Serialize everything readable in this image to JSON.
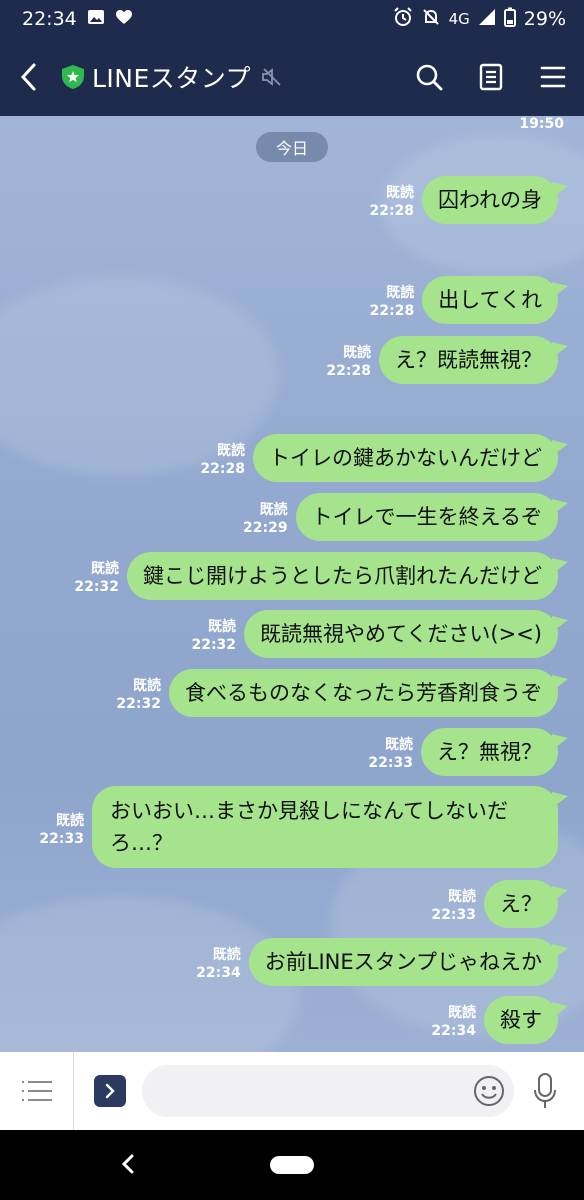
{
  "status_bar": {
    "time": "22:34",
    "network": "4G",
    "battery": "29%"
  },
  "header": {
    "title": "LINEスタンプ"
  },
  "chat": {
    "previous_time": "19:50",
    "date_label": "今日",
    "messages": [
      {
        "read": "既読",
        "time": "22:28",
        "text": "囚われの身"
      },
      {
        "read": "既読",
        "time": "22:28",
        "text": "出してくれ"
      },
      {
        "read": "既読",
        "time": "22:28",
        "text": "え？既読無視？"
      },
      {
        "read": "既読",
        "time": "22:28",
        "text": "トイレの鍵あかないんだけど"
      },
      {
        "read": "既読",
        "time": "22:29",
        "text": "トイレで一生を終えるぞ"
      },
      {
        "read": "既読",
        "time": "22:32",
        "text": "鍵こじ開けようとしたら爪割れたんだけど"
      },
      {
        "read": "既読",
        "time": "22:32",
        "text": "既読無視やめてください(><)"
      },
      {
        "read": "既読",
        "time": "22:32",
        "text": "食べるものなくなったら芳香剤食うぞ"
      },
      {
        "read": "既読",
        "time": "22:33",
        "text": "え？無視？"
      },
      {
        "read": "既読",
        "time": "22:33",
        "text": "おいおい…まさか見殺しになんてしないだろ…？"
      },
      {
        "read": "既読",
        "time": "22:33",
        "text": "え？"
      },
      {
        "read": "既読",
        "time": "22:34",
        "text": "お前LINEスタンプじゃねえか"
      },
      {
        "read": "既読",
        "time": "22:34",
        "text": "殺す"
      }
    ]
  },
  "input": {
    "placeholder": ""
  },
  "colors": {
    "header_bg": "#1f2b4d",
    "bubble": "#a5e38d",
    "chat_bg": "#96abd0",
    "shield": "#2db94d"
  }
}
